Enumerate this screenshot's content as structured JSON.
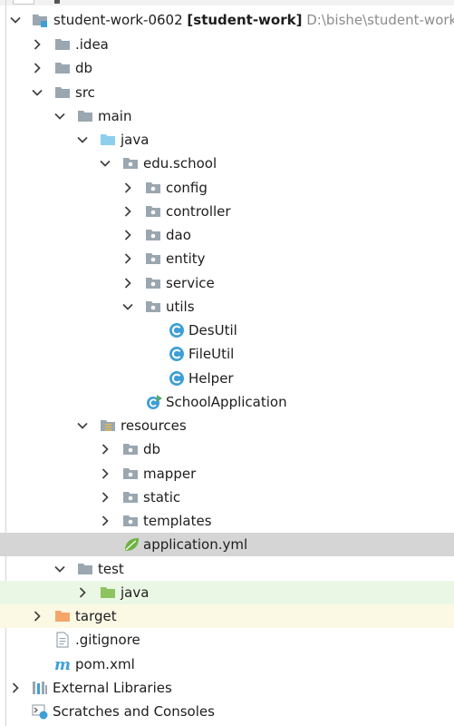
{
  "tree": {
    "root": {
      "name": "student-work-0602",
      "module": "[student-work]",
      "path": "D:\\bishe\\student-work-0"
    },
    "idea": ".idea",
    "db": "db",
    "src": "src",
    "main": "main",
    "java": "java",
    "package": "edu.school",
    "config": "config",
    "controller": "controller",
    "dao": "dao",
    "entity": "entity",
    "service": "service",
    "utils": "utils",
    "desutil": "DesUtil",
    "fileutil": "FileUtil",
    "helper": "Helper",
    "app": "SchoolApplication",
    "resources": "resources",
    "res_db": "db",
    "mapper": "mapper",
    "static": "static",
    "templates": "templates",
    "yml": "application.yml",
    "test": "test",
    "test_java": "java",
    "target": "target",
    "gitignore": ".gitignore",
    "pom": "pom.xml",
    "extlibs": "External Libraries",
    "scratches": "Scratches and Consoles"
  },
  "colors": {
    "folder": "#9aa7b0",
    "source_folder": "#8ccfee",
    "test_folder": "#8dc45f",
    "excluded_folder": "#f6a66b",
    "class_icon": "#3e9fd6",
    "selection": "#d5d5d5"
  }
}
